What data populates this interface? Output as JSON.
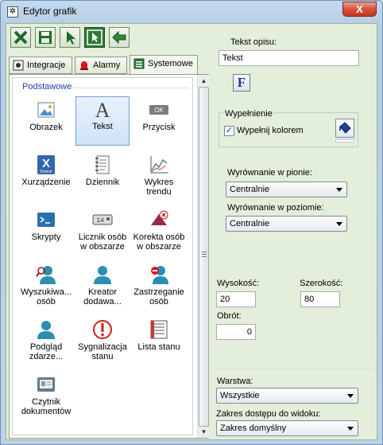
{
  "window": {
    "title": "Edytor grafik",
    "close_glyph": "X"
  },
  "toolbar": {
    "buttons": [
      {
        "name": "close-icon"
      },
      {
        "name": "save-icon"
      },
      {
        "name": "cursor-icon"
      },
      {
        "name": "select-cursor-icon"
      },
      {
        "name": "back-arrow-icon"
      }
    ]
  },
  "tabs": [
    {
      "label": "Integracje",
      "icon": "integration-icon"
    },
    {
      "label": "Alarmy",
      "icon": "alarm-bell-icon"
    },
    {
      "label": "Systemowe",
      "icon": "system-icon",
      "selected": true
    }
  ],
  "palette": {
    "section": "Podstawowe",
    "items": [
      {
        "label": "Obrazek",
        "icon": "image-icon"
      },
      {
        "label": "Tekst",
        "icon": "text-icon",
        "selected": true
      },
      {
        "label": "Przycisk",
        "icon": "button-icon",
        "ok": "OK"
      },
      {
        "label": "Xurządzenie",
        "icon": "device-icon",
        "x": "X",
        "sub": "Device"
      },
      {
        "label": "Dziennik",
        "icon": "journal-icon"
      },
      {
        "label": "Wykres trendu",
        "icon": "trend-chart-icon"
      },
      {
        "label": "Skrypty",
        "icon": "script-icon"
      },
      {
        "label": "Licznik osób w obszarze",
        "icon": "counter-icon",
        "digits": "14"
      },
      {
        "label": "Korekta osób w obszarze",
        "icon": "correction-icon"
      },
      {
        "label": "Wyszukiwa... osób",
        "icon": "person-search-icon"
      },
      {
        "label": "Kreator dodawa...",
        "icon": "person-add-icon"
      },
      {
        "label": "Zastrzeganie osób",
        "icon": "person-block-icon"
      },
      {
        "label": "Podgląd zdarze...",
        "icon": "person-view-icon"
      },
      {
        "label": "Sygnalizacja stanu",
        "icon": "alert-icon"
      },
      {
        "label": "Lista stanu",
        "icon": "list-icon"
      },
      {
        "label": "Czytnik dokumentów",
        "icon": "document-reader-icon"
      }
    ]
  },
  "properties": {
    "text_label": "Tekst opisu:",
    "text_value": "Tekst",
    "font_button": "F",
    "fill_group": "Wypełnienie",
    "fill_checkbox_label": "Wypełnij kolorem",
    "fill_checked": "✓",
    "valign_label": "Wyrównanie w pionie:",
    "valign_value": "Centralnie",
    "halign_label": "Wyrównanie w poziomie:",
    "halign_value": "Centralnie",
    "height_label": "Wysokość:",
    "height_value": "20",
    "width_label": "Szerokość:",
    "width_value": "80",
    "rotation_label": "Obrót:",
    "rotation_value": "0",
    "layer_label": "Warstwa:",
    "layer_value": "Wszystkie",
    "access_label": "Zakres dostępu do widoku:",
    "access_value": "Zakres domyślny"
  }
}
